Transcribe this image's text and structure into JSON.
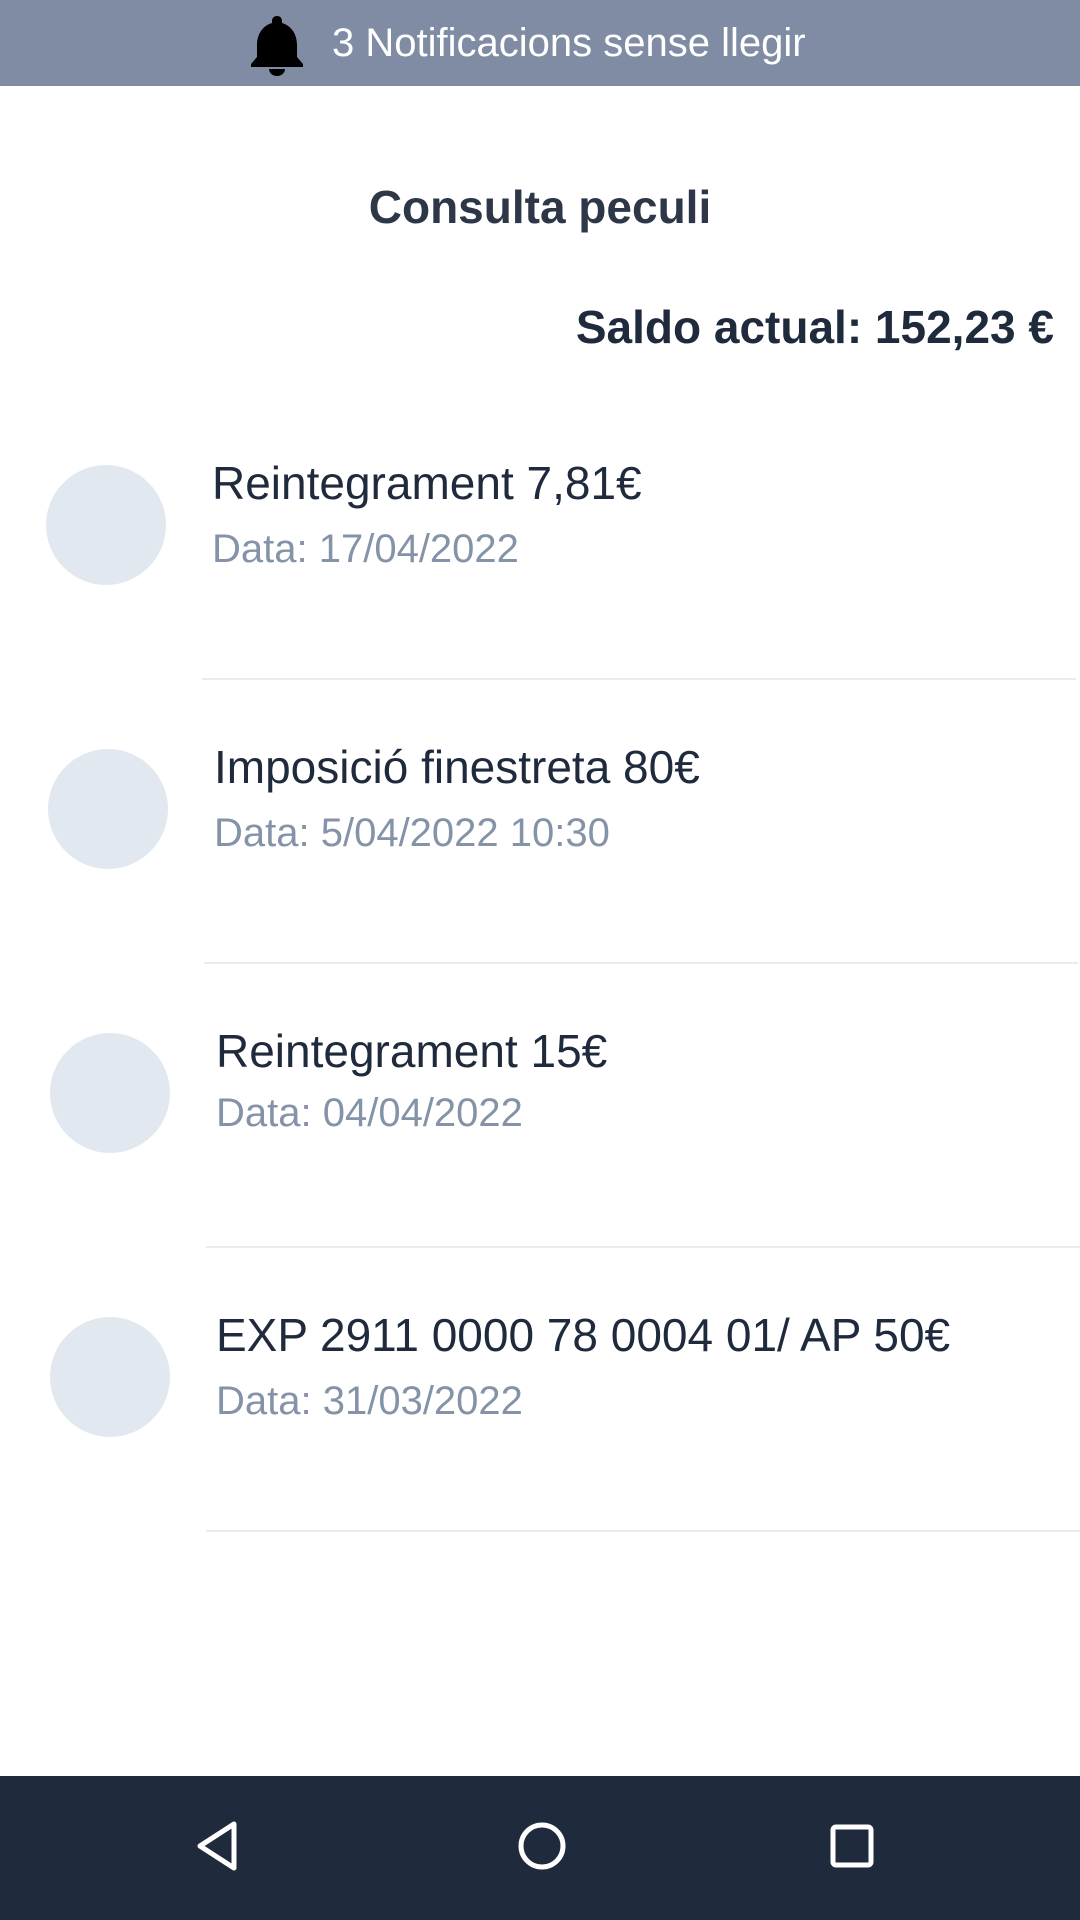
{
  "notification_bar": {
    "text": "3 Notificacions sense llegir",
    "icon": "bell-icon"
  },
  "page": {
    "title": "Consulta peculi",
    "balance": "Saldo actual: 152,23 €"
  },
  "transactions": [
    {
      "title": "Reintegrament 7,81€",
      "date": "Data: 17/04/2022"
    },
    {
      "title": "Imposició finestreta 80€",
      "date": "Data: 5/04/2022 10:30"
    },
    {
      "title": "Reintegrament 15€",
      "date": "Data: 04/04/2022"
    },
    {
      "title": "EXP 2911 0000 78 0004 01/ AP 50€",
      "date": "Data: 31/03/2022"
    }
  ],
  "navigation": {
    "back_icon": "back-triangle-icon",
    "home_icon": "home-circle-icon",
    "recents_icon": "recents-square-icon"
  },
  "colors": {
    "notification_bg": "#7f8ca3",
    "nav_bg": "#1f2a3c",
    "avatar_bg": "#e2e8f0",
    "date_text": "#8593a8"
  }
}
